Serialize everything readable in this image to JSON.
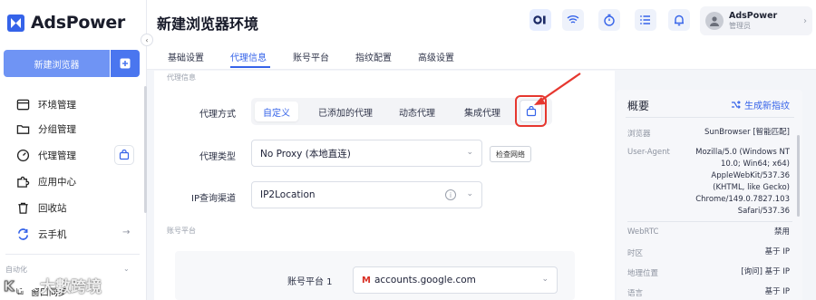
{
  "app": {
    "brand": "AdsPower"
  },
  "sidebar": {
    "new_env_label": "新建浏览器",
    "items": [
      {
        "label": "环境管理",
        "icon": "window-icon"
      },
      {
        "label": "分组管理",
        "icon": "folder-icon"
      },
      {
        "label": "代理管理",
        "icon": "gauge-icon"
      },
      {
        "label": "应用中心",
        "icon": "puzzle-icon"
      },
      {
        "label": "回收站",
        "icon": "trash-icon"
      },
      {
        "label": "云手机",
        "icon": "sync-icon"
      }
    ],
    "arrow_glyph": "→",
    "section_label": "自动化",
    "window_sync_label": "窗口同步",
    "watermark": "大數跨境"
  },
  "header": {
    "title": "新建浏览器环境",
    "user": {
      "name": "AdsPower",
      "role": "管理员"
    }
  },
  "tabs": [
    {
      "label": "基础设置",
      "active": false
    },
    {
      "label": "代理信息",
      "active": true
    },
    {
      "label": "账号平台",
      "active": false
    },
    {
      "label": "指纹配置",
      "active": false
    },
    {
      "label": "高级设置",
      "active": false
    }
  ],
  "proxy": {
    "section_label": "代理信息",
    "method_label": "代理方式",
    "methods": [
      "自定义",
      "已添加的代理",
      "动态代理",
      "集成代理"
    ],
    "type_label": "代理类型",
    "type_value": "No Proxy (本地直连)",
    "check_network_label": "检查网络",
    "ip_channel_label": "IP查询渠道",
    "ip_channel_value": "IP2Location"
  },
  "account": {
    "section_label": "账号平台",
    "platform_label": "账号平台",
    "item_label": "账号平台 1",
    "item_value": "accounts.google.com"
  },
  "overview": {
    "title": "概要",
    "generate_label": "生成新指纹",
    "rows": [
      {
        "key": "浏览器",
        "value": "SunBrowser [智能匹配]"
      },
      {
        "key": "User-Agent",
        "value": [
          "Mozilla/5.0 (Windows NT",
          "10.0; Win64; x64)",
          "AppleWebKit/537.36",
          "(KHTML, like Gecko)",
          "Chrome/149.0.7827.103",
          "Safari/537.36"
        ]
      },
      {
        "key": "WebRTC",
        "value": "禁用"
      },
      {
        "key": "时区",
        "value": "基于 IP"
      },
      {
        "key": "地理位置",
        "value": "[询问] 基于 IP"
      },
      {
        "key": "语言",
        "value": "基于 IP"
      }
    ]
  },
  "colors": {
    "accent": "#3563e9",
    "annotation": "#e6372f",
    "primary_button": "#6f94f4"
  }
}
